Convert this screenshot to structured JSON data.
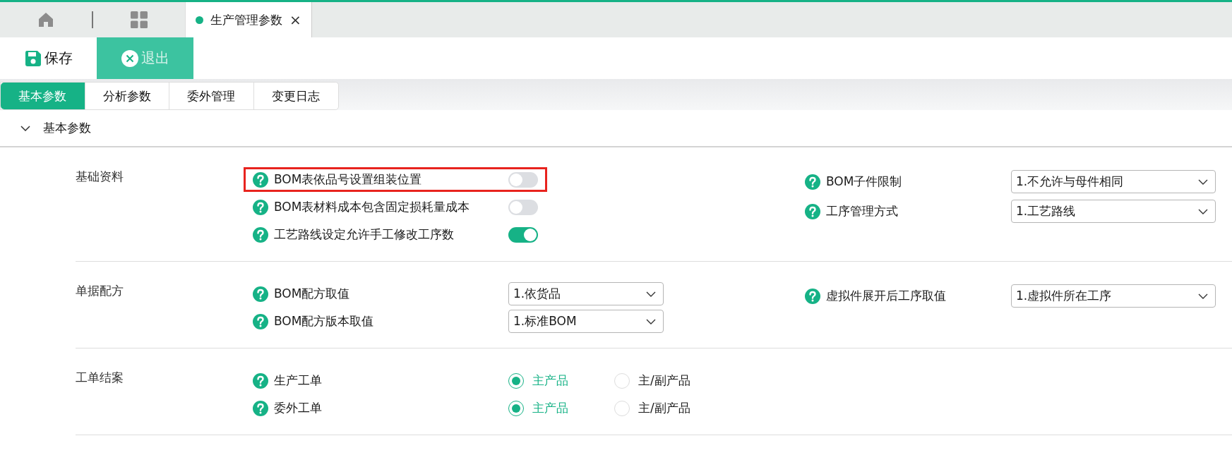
{
  "top_tabs": [
    {
      "kind": "home"
    },
    {
      "kind": "grid"
    },
    {
      "kind": "page",
      "label": "生产管理参数",
      "close": "×",
      "selected": true
    }
  ],
  "toolbar": [
    {
      "kind": "save",
      "label": "保存"
    },
    {
      "kind": "exit",
      "label": "退出",
      "disabled": true
    }
  ],
  "tabs": [
    {
      "label": "基本参数",
      "selected": true
    },
    {
      "label": "分析参数",
      "selected": false
    },
    {
      "label": "委外管理",
      "selected": false
    },
    {
      "label": "变更日志",
      "selected": false
    }
  ],
  "section": {
    "title": "基本参数",
    "expanded": true
  },
  "groups": [
    {
      "label": "基础资料",
      "left": [
        {
          "kind": "toggle",
          "label": "BOM表依品号设置组装位置",
          "on": false,
          "highlighted": true
        },
        {
          "kind": "toggle",
          "label": "BOM表材料成本包含固定损耗量成本",
          "on": false,
          "highlighted": false
        },
        {
          "kind": "toggle",
          "label": "工艺路线设定允许手工修改工序数",
          "on": true,
          "highlighted": false
        }
      ],
      "right": [
        {
          "kind": "select",
          "label": "BOM子件限制",
          "value": "1.不允许与母件相同"
        },
        {
          "kind": "select",
          "label": "工序管理方式",
          "value": "1.工艺路线"
        }
      ]
    },
    {
      "label": "单据配方",
      "left": [
        {
          "kind": "select",
          "label": "BOM配方取值",
          "value": "1.依货品",
          "highlighted": false
        },
        {
          "kind": "select",
          "label": "BOM配方版本取值",
          "value": "1.标准BOM",
          "highlighted": false
        }
      ],
      "right": [
        {
          "kind": "select",
          "label": "虚拟件展开后工序取值",
          "value": "1.虚拟件所在工序"
        }
      ]
    },
    {
      "label": "工单结案",
      "left": [
        {
          "kind": "radio",
          "label": "生产工单",
          "highlighted": false,
          "options": [
            {
              "label": "主产品",
              "selected": true
            },
            {
              "label": "主/副产品",
              "selected": false
            }
          ]
        },
        {
          "kind": "radio",
          "label": "委外工单",
          "highlighted": false,
          "options": [
            {
              "label": "主产品",
              "selected": true
            },
            {
              "label": "主/副产品",
              "selected": false
            }
          ]
        }
      ]
    }
  ]
}
